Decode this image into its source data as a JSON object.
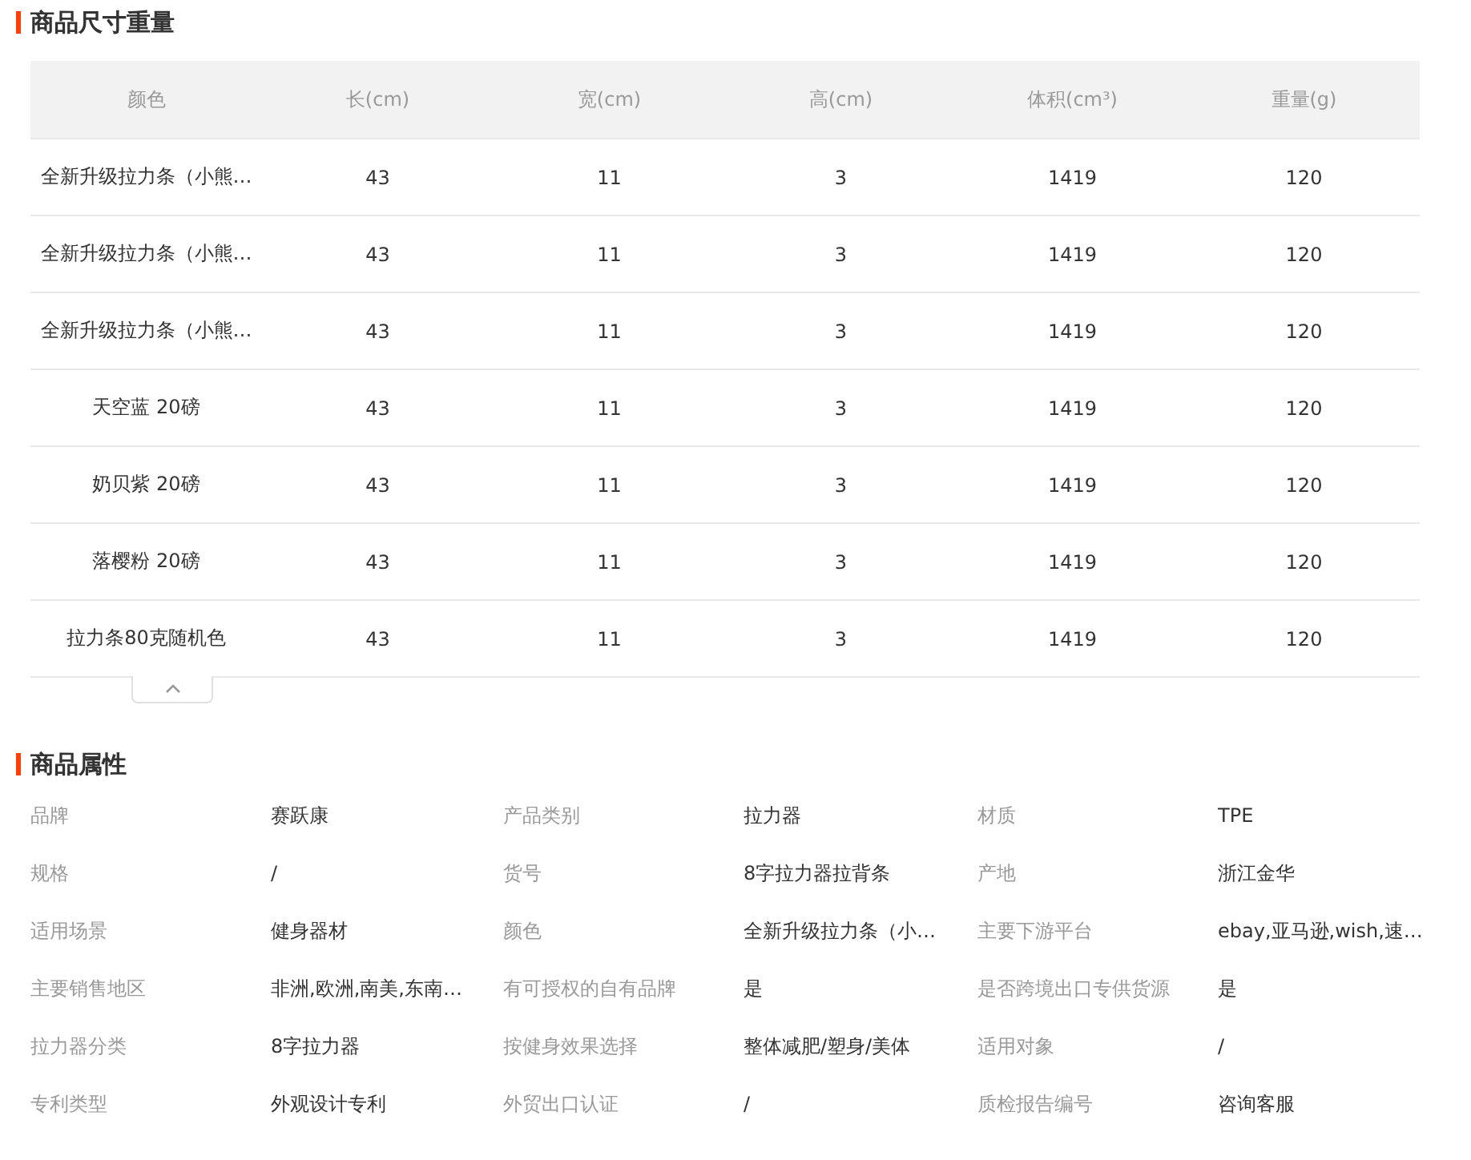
{
  "size_section": {
    "title": "商品尺寸重量",
    "columns": [
      "颜色",
      "长(cm)",
      "宽(cm)",
      "高(cm)",
      "体积(cm³)",
      "重量(g)"
    ],
    "rows": [
      [
        "全新升级拉力条（小熊…",
        "43",
        "11",
        "3",
        "1419",
        "120"
      ],
      [
        "全新升级拉力条（小熊…",
        "43",
        "11",
        "3",
        "1419",
        "120"
      ],
      [
        "全新升级拉力条（小熊…",
        "43",
        "11",
        "3",
        "1419",
        "120"
      ],
      [
        "天空蓝 20磅",
        "43",
        "11",
        "3",
        "1419",
        "120"
      ],
      [
        "奶贝紫 20磅",
        "43",
        "11",
        "3",
        "1419",
        "120"
      ],
      [
        "落樱粉 20磅",
        "43",
        "11",
        "3",
        "1419",
        "120"
      ],
      [
        "拉力条80克随机色",
        "43",
        "11",
        "3",
        "1419",
        "120"
      ]
    ],
    "expanded": true
  },
  "attributes_section": {
    "title": "商品属性",
    "items": [
      {
        "label": "品牌",
        "value": "赛跃康"
      },
      {
        "label": "产品类别",
        "value": "拉力器"
      },
      {
        "label": "材质",
        "value": "TPE"
      },
      {
        "label": "规格",
        "value": "/"
      },
      {
        "label": "货号",
        "value": "8字拉力器拉背条"
      },
      {
        "label": "产地",
        "value": "浙江金华"
      },
      {
        "label": "适用场景",
        "value": "健身器材"
      },
      {
        "label": "颜色",
        "value": "全新升级拉力条（小…"
      },
      {
        "label": "主要下游平台",
        "value": "ebay,亚马逊,wish,速…"
      },
      {
        "label": "主要销售地区",
        "value": "非洲,欧洲,南美,东南…"
      },
      {
        "label": "有可授权的自有品牌",
        "value": "是"
      },
      {
        "label": "是否跨境出口专供货源",
        "value": "是"
      },
      {
        "label": "拉力器分类",
        "value": "8字拉力器"
      },
      {
        "label": "按健身效果选择",
        "value": "整体减肥/塑身/美体"
      },
      {
        "label": "适用对象",
        "value": "/"
      },
      {
        "label": "专利类型",
        "value": "外观设计专利"
      },
      {
        "label": "外贸出口认证",
        "value": "/"
      },
      {
        "label": "质检报告编号",
        "value": "咨询客服"
      }
    ]
  }
}
